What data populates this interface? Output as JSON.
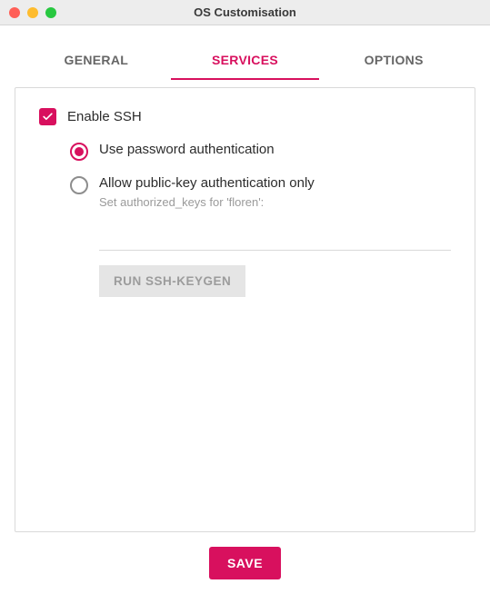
{
  "window": {
    "title": "OS Customisation"
  },
  "tabs": {
    "general": "GENERAL",
    "services": "SERVICES",
    "options": "OPTIONS",
    "active": "services"
  },
  "ssh": {
    "enable_label": "Enable SSH",
    "enabled": true,
    "auth_password_label": "Use password authentication",
    "auth_pubkey_label": "Allow public-key authentication only",
    "auth_selected": "password",
    "authorized_keys_hint": "Set authorized_keys for 'floren':",
    "authorized_keys_value": "",
    "keygen_button": "RUN SSH-KEYGEN"
  },
  "footer": {
    "save_label": "SAVE"
  }
}
